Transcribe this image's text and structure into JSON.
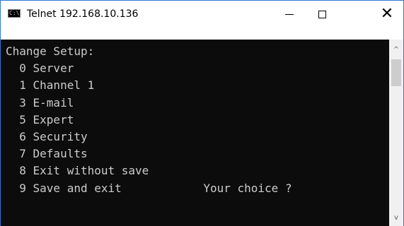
{
  "window": {
    "title": "Telnet 192.168.10.136",
    "icon_text": "C:\\."
  },
  "controls": {
    "minimize_icon": "minimize-icon",
    "maximize_icon": "maximize-icon",
    "close_glyph": "✕"
  },
  "terminal": {
    "lines": [
      "Change Setup:",
      "  0 Server",
      "  1 Channel 1",
      "  3 E-mail",
      "  5 Expert",
      "  6 Security",
      "  7 Defaults",
      "  8 Exit without save",
      "  9 Save and exit            Your choice ?"
    ],
    "background": "#0c0c0c",
    "foreground": "#cccccc"
  },
  "scrollbar": {
    "up_glyph": "^",
    "down_glyph": "v"
  }
}
